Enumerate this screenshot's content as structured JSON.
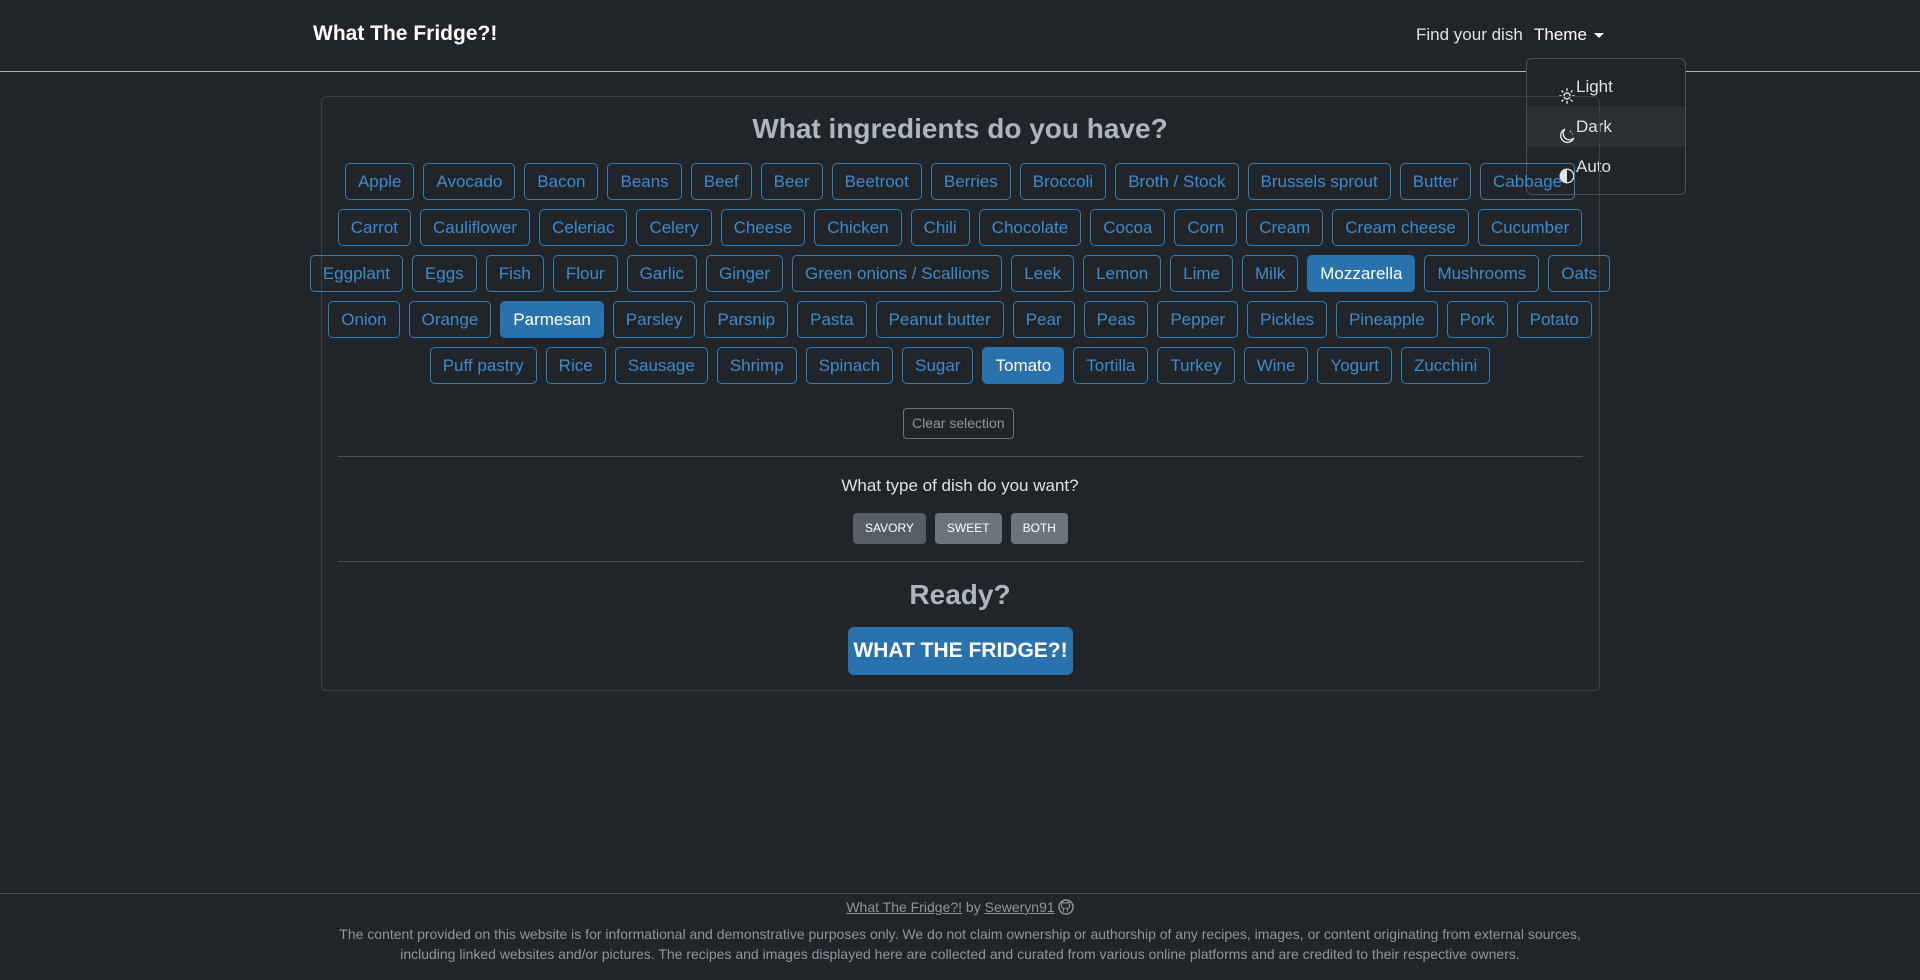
{
  "navbar": {
    "brand": "What The Fridge?!",
    "find_link": "Find your dish",
    "theme_label": "Theme"
  },
  "theme_menu": {
    "items": [
      {
        "label": "Light",
        "icon": "sun-icon"
      },
      {
        "label": "Dark",
        "icon": "moon-icon",
        "active": true
      },
      {
        "label": "Auto",
        "icon": "half-circle-icon"
      }
    ]
  },
  "ingredients_title": "What ingredients do you have?",
  "ingredient_rows": [
    [
      "Apple",
      "Avocado",
      "Bacon",
      "Beans",
      "Beef",
      "Beer",
      "Beetroot",
      "Berries",
      "Broccoli",
      "Broth / Stock",
      "Brussels sprout",
      "Butter",
      "Cabbage"
    ],
    [
      "Carrot",
      "Cauliflower",
      "Celeriac",
      "Celery",
      "Cheese",
      "Chicken",
      "Chili",
      "Chocolate",
      "Cocoa",
      "Corn",
      "Cream",
      "Cream cheese",
      "Cucumber"
    ],
    [
      "Eggplant",
      "Eggs",
      "Fish",
      "Flour",
      "Garlic",
      "Ginger",
      "Green onions / Scallions",
      "Leek",
      "Lemon",
      "Lime",
      "Milk",
      "Mozzarella",
      "Mushrooms",
      "Oats"
    ],
    [
      "Onion",
      "Orange",
      "Parmesan",
      "Parsley",
      "Parsnip",
      "Pasta",
      "Peanut butter",
      "Pear",
      "Peas",
      "Pepper",
      "Pickles",
      "Pineapple",
      "Pork",
      "Potato"
    ],
    [
      "Puff pastry",
      "Rice",
      "Sausage",
      "Shrimp",
      "Spinach",
      "Sugar",
      "Tomato",
      "Tortilla",
      "Turkey",
      "Wine",
      "Yogurt",
      "Zucchini"
    ]
  ],
  "selected_ingredients": [
    "Mozzarella",
    "Parmesan",
    "Tomato"
  ],
  "clear_label": "Clear selection",
  "dish_question": "What type of dish do you want?",
  "dish_types": [
    "SAVORY",
    "SWEET",
    "BOTH"
  ],
  "ready_label": "Ready?",
  "cta_label": "WHAT THE FRIDGE?!",
  "footer": {
    "app_link": "What The Fridge?!",
    "by": "by",
    "author_link": "Seweryn91",
    "disclaimer": "The content provided on this website is for informational and demonstrative purposes only. We do not claim ownership or authorship of any recipes, images, or content originating from external sources, including linked websites and/or pictures. The recipes and images displayed here are collected and curated from various online platforms and are credited to their respective owners."
  },
  "colors": {
    "background": "#212529",
    "accent": "#2a72ae",
    "chip_text": "#3d8bcd"
  }
}
